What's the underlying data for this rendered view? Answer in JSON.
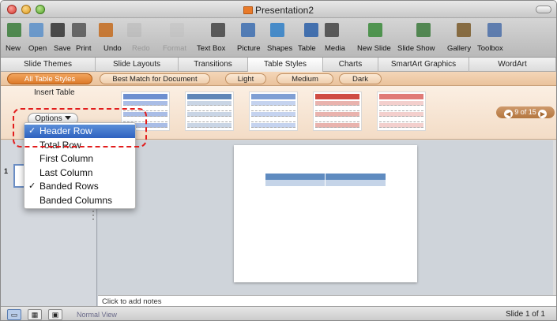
{
  "window": {
    "title": "Presentation2"
  },
  "toolbar": {
    "items": [
      {
        "label": "New",
        "icon": "new-presentation-icon",
        "dim": false
      },
      {
        "label": "Open",
        "icon": "open-folder-icon",
        "dim": false
      },
      {
        "label": "Save",
        "icon": "save-disk-icon",
        "dim": false
      },
      {
        "label": "Print",
        "icon": "printer-icon",
        "dim": false
      },
      {
        "label": "Undo",
        "icon": "undo-icon",
        "dim": false
      },
      {
        "label": "Redo",
        "icon": "redo-icon",
        "dim": true
      },
      {
        "label": "Format",
        "icon": "format-brush-icon",
        "dim": true
      },
      {
        "label": "Text Box",
        "icon": "text-box-icon",
        "dim": false
      },
      {
        "label": "Picture",
        "icon": "picture-icon",
        "dim": false
      },
      {
        "label": "Shapes",
        "icon": "shapes-icon",
        "dim": false
      },
      {
        "label": "Table",
        "icon": "table-icon",
        "dim": false
      },
      {
        "label": "Media",
        "icon": "media-icon",
        "dim": false
      },
      {
        "label": "New Slide",
        "icon": "new-slide-icon",
        "dim": false
      },
      {
        "label": "Slide Show",
        "icon": "slide-show-icon",
        "dim": false
      },
      {
        "label": "Gallery",
        "icon": "gallery-icon",
        "dim": false
      },
      {
        "label": "Toolbox",
        "icon": "toolbox-icon",
        "dim": false
      }
    ]
  },
  "tabs": [
    "Slide Themes",
    "Slide Layouts",
    "Transitions",
    "Table Styles",
    "Charts",
    "SmartArt Graphics",
    "WordArt"
  ],
  "active_tab": "Table Styles",
  "filters": [
    "All Table Styles",
    "Best Match for Document",
    "Light",
    "Medium",
    "Dark"
  ],
  "active_filter": "All Table Styles",
  "ribbon": {
    "insert_table": "Insert Table",
    "options_label": "Options",
    "pager": "9 of 15"
  },
  "table_styles": [
    {
      "header": "#6d8fd0",
      "row": "#a9bde6"
    },
    {
      "header": "#5f86b8",
      "row": "#c9d5e5"
    },
    {
      "header": "#7f9fd4",
      "row": "#c5d3ef"
    },
    {
      "header": "#cf4b43",
      "row": "#e9b3ae"
    },
    {
      "header": "#e07a77",
      "row": "#f3cfcd"
    }
  ],
  "options_menu": [
    {
      "label": "Header Row",
      "checked": true,
      "highlighted": true
    },
    {
      "label": "Total Row",
      "checked": false,
      "highlighted": false
    },
    {
      "label": "First Column",
      "checked": false,
      "highlighted": false
    },
    {
      "label": "Last Column",
      "checked": false,
      "highlighted": false
    },
    {
      "label": "Banded Rows",
      "checked": true,
      "highlighted": false
    },
    {
      "label": "Banded Columns",
      "checked": false,
      "highlighted": false
    }
  ],
  "slides_pane": {
    "slide_number": "1"
  },
  "notes": {
    "placeholder": "Click to add notes"
  },
  "status": {
    "view": "Normal View",
    "slide": "Slide 1 of 1"
  },
  "colors": {
    "ribbon_accent": "#e98a3c",
    "menu_highlight": "#2e62c0",
    "callout": "#e21c1c",
    "table_header": "#5f8bc0"
  }
}
